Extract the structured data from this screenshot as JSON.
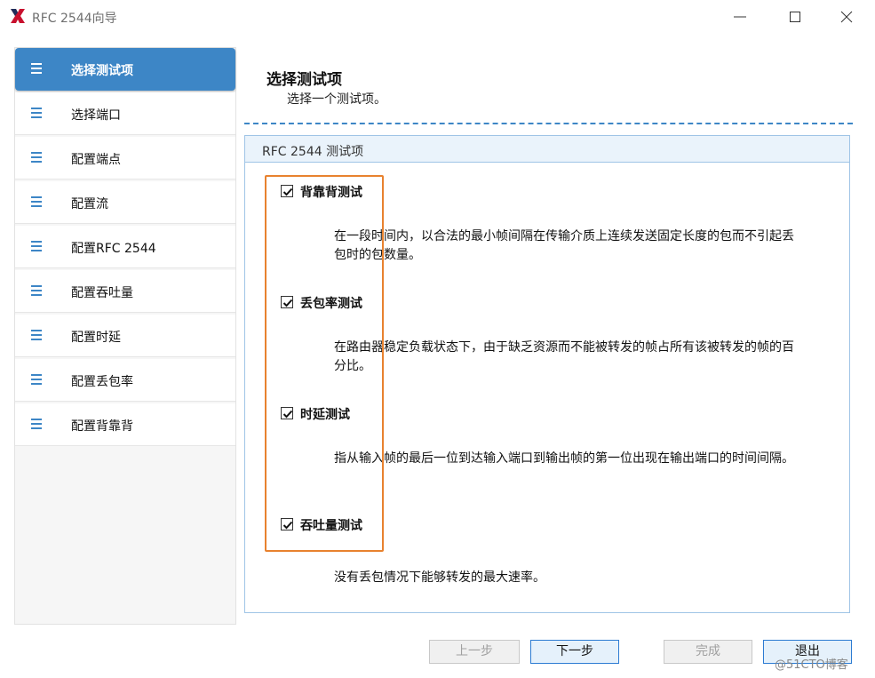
{
  "window": {
    "title": "RFC 2544向导"
  },
  "sidebar": {
    "items": [
      {
        "label": "选择测试项",
        "active": true
      },
      {
        "label": "选择端口"
      },
      {
        "label": "配置端点"
      },
      {
        "label": "配置流"
      },
      {
        "label": "配置RFC 2544"
      },
      {
        "label": "配置吞吐量"
      },
      {
        "label": "配置时延"
      },
      {
        "label": "配置丢包率"
      },
      {
        "label": "配置背靠背"
      }
    ]
  },
  "main": {
    "title": "选择测试项",
    "subtitle": "选择一个测试项。",
    "group_title": "RFC 2544 测试项",
    "tests": [
      {
        "name": "背靠背测试",
        "checked": true,
        "description": "在一段时间内，以合法的最小帧间隔在传输介质上连续发送固定长度的包而不引起丢包时的包数量。"
      },
      {
        "name": "丢包率测试",
        "checked": true,
        "description": "在路由器稳定负载状态下，由于缺乏资源而不能被转发的帧占所有该被转发的帧的百分比。"
      },
      {
        "name": "时延测试",
        "checked": true,
        "description": "指从输入帧的最后一位到达输入端口到输出帧的第一位出现在输出端口的时间间隔。"
      },
      {
        "name": "吞吐量测试",
        "checked": true,
        "description": "没有丢包情况下能够转发的最大速率。"
      }
    ]
  },
  "footer": {
    "prev_label": "上一步",
    "next_label": "下一步",
    "finish_label": "完成",
    "exit_label": "退出"
  },
  "watermark": "@51CTO博客",
  "colors": {
    "accent": "#3d86c6",
    "highlight_box": "#e8822f",
    "logo": "#c8102e"
  }
}
